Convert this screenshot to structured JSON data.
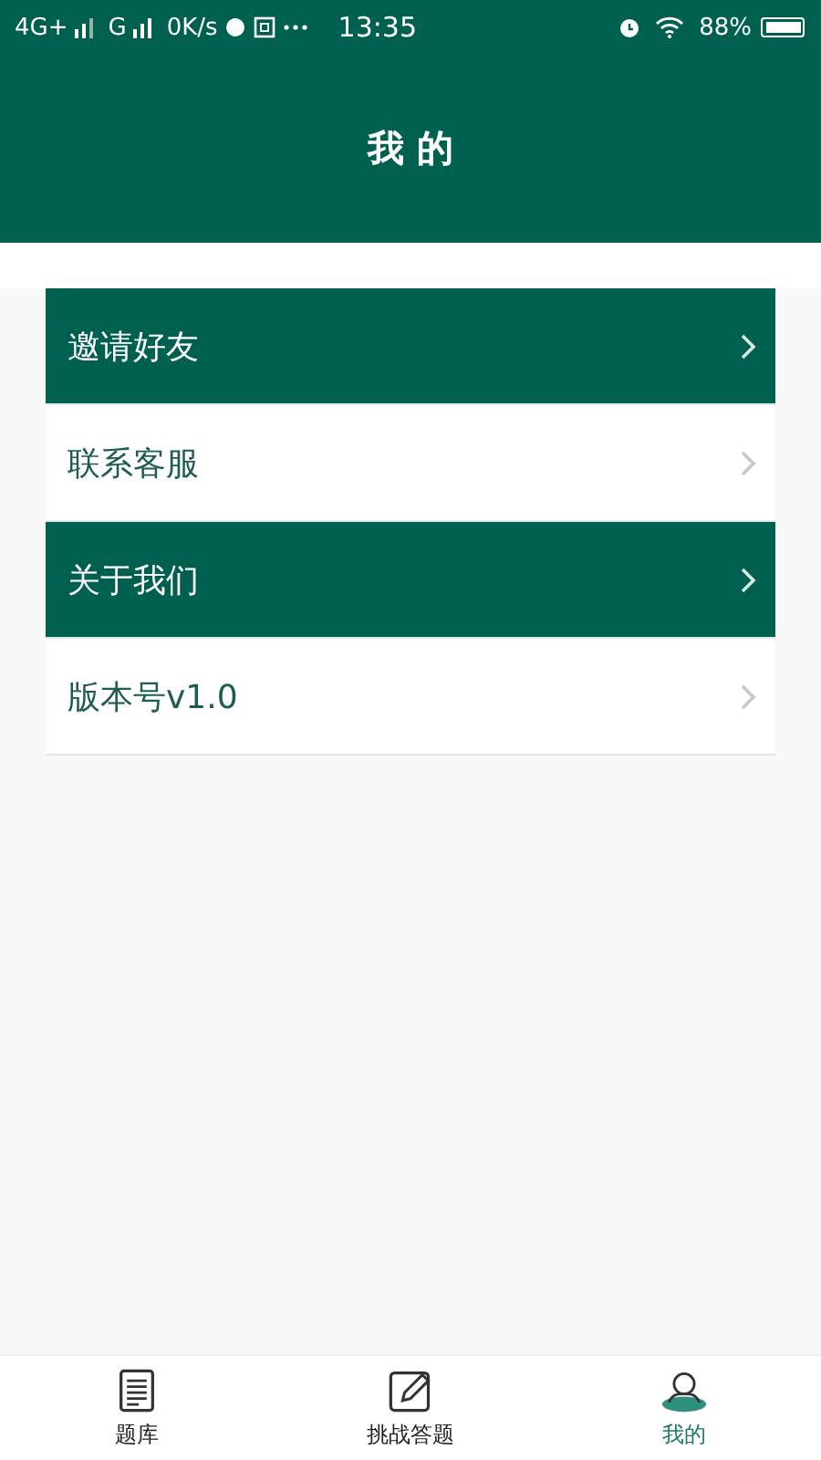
{
  "status_bar": {
    "network_1": "4G+",
    "network_2": "G",
    "speed": "0K/s",
    "time": "13:35",
    "battery": "88%"
  },
  "header": {
    "title": "我 的"
  },
  "menu": [
    {
      "label": "邀请好友",
      "highlighted": true
    },
    {
      "label": "联系客服",
      "highlighted": false
    },
    {
      "label": "关于我们",
      "highlighted": true
    },
    {
      "label": "版本号v1.0",
      "highlighted": false
    }
  ],
  "tabs": [
    {
      "label": "题库",
      "kind": "document",
      "selected": false
    },
    {
      "label": "挑战答题",
      "kind": "edit",
      "selected": false
    },
    {
      "label": "我的",
      "kind": "person",
      "selected": true
    }
  ]
}
